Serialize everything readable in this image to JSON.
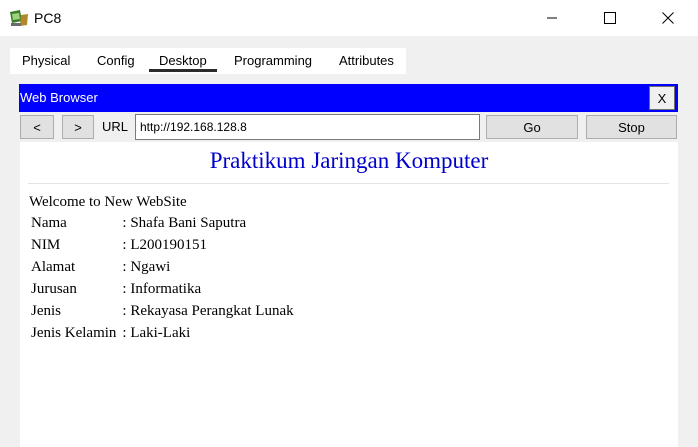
{
  "window": {
    "title": "PC8"
  },
  "tabs": [
    {
      "label": "Physical"
    },
    {
      "label": "Config"
    },
    {
      "label": "Desktop"
    },
    {
      "label": "Programming"
    },
    {
      "label": "Attributes"
    }
  ],
  "active_tab": "Desktop",
  "browser": {
    "title": "Web Browser",
    "close_label": "X",
    "back_label": "<",
    "forward_label": ">",
    "url_label": "URL",
    "url_value": "http://192.168.128.8",
    "go_label": "Go",
    "stop_label": "Stop"
  },
  "page": {
    "heading": "Praktikum Jaringan Komputer",
    "welcome": "Welcome to New WebSite",
    "rows": [
      {
        "key": "Nama",
        "value": ": Shafa Bani Saputra"
      },
      {
        "key": "NIM",
        "value": ": L200190151"
      },
      {
        "key": "Alamat",
        "value": ": Ngawi"
      },
      {
        "key": "Jurusan",
        "value": ": Informatika"
      },
      {
        "key": "Jenis",
        "value": ": Rekayasa Perangkat Lunak"
      },
      {
        "key": "Jenis Kelamin",
        "value": ": Laki-Laki"
      }
    ]
  },
  "colors": {
    "browser_titlebar": "#0000ff",
    "heading": "#0000cc"
  },
  "icons": {
    "app": "packet-tracer-pc-icon",
    "minimize": "minimize-icon",
    "maximize": "maximize-icon",
    "close": "close-icon"
  }
}
